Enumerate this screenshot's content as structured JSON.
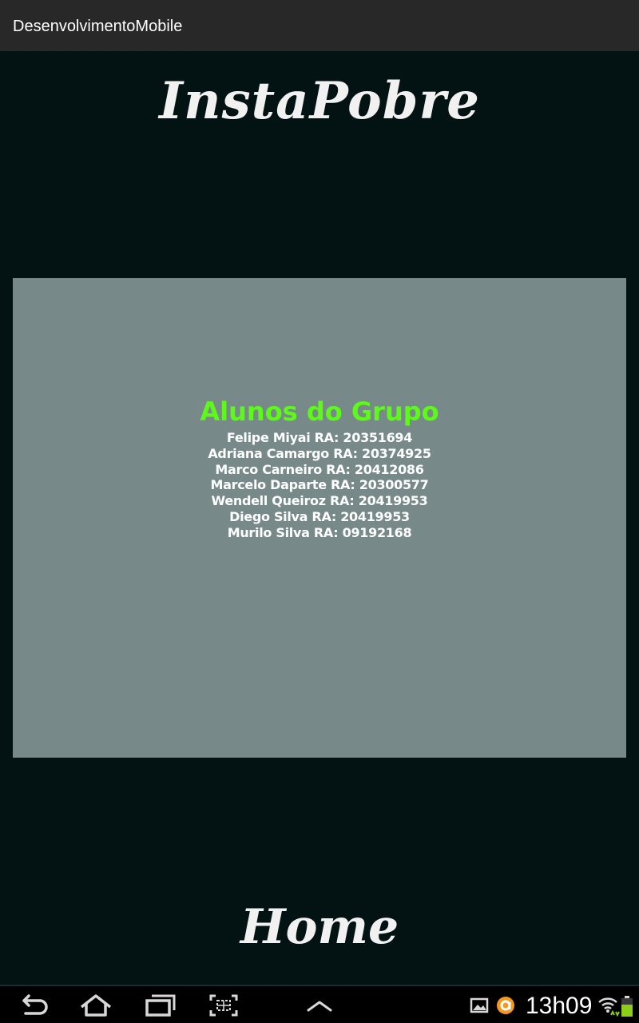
{
  "app": {
    "title": "DesenvolvimentoMobile"
  },
  "logo": {
    "text": "InstaPobre"
  },
  "group": {
    "heading": "Alunos do Grupo",
    "students": [
      "Felipe Miyai RA: 20351694",
      "Adriana Camargo RA: 20374925",
      "Marco Carneiro RA: 20412086",
      "Marcelo Daparte RA: 20300577",
      "Wendell Queiroz RA: 20419953",
      "Diego Silva RA: 20419953",
      "Murilo Silva RA: 09192168"
    ]
  },
  "home": {
    "label": "Home"
  },
  "system": {
    "clock": "13h09",
    "nav_icons": [
      "back-icon",
      "home-icon",
      "recent-apps-icon",
      "screenshot-icon",
      "menu-up-icon"
    ],
    "status_icons": [
      "gallery-icon",
      "app-notification-icon",
      "wifi-icon",
      "battery-icon"
    ]
  },
  "colors": {
    "background": "#031314",
    "action_bar": "#282828",
    "panel": "#778a89",
    "heading": "#5cf91a",
    "text": "#ffffff"
  }
}
